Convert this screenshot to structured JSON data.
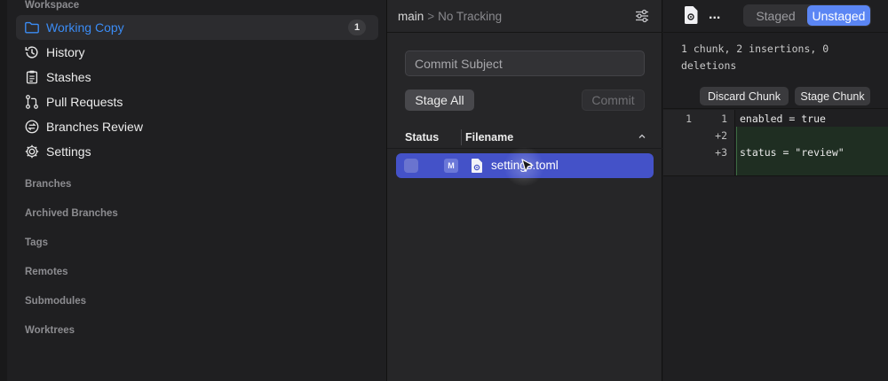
{
  "sidebar": {
    "workspace_header": "Workspace",
    "items": [
      {
        "label": "Working Copy",
        "icon": "folder-icon",
        "badge": "1",
        "active": true
      },
      {
        "label": "History",
        "icon": "history-clock-icon"
      },
      {
        "label": "Stashes",
        "icon": "clipboard-icon"
      },
      {
        "label": "Pull Requests",
        "icon": "pull-request-icon"
      },
      {
        "label": "Branches Review",
        "icon": "branches-review-icon"
      },
      {
        "label": "Settings",
        "icon": "gear-icon"
      }
    ],
    "sections": [
      "Branches",
      "Archived Branches",
      "Tags",
      "Remotes",
      "Submodules",
      "Worktrees"
    ]
  },
  "middle": {
    "branch": "main",
    "separator": ">",
    "tracking": "No Tracking",
    "commit_placeholder": "Commit Subject",
    "stage_all_label": "Stage All",
    "commit_label": "Commit",
    "table": {
      "col_status": "Status",
      "col_filename": "Filename",
      "rows": [
        {
          "status_badge": "M",
          "filename": "settings.toml",
          "selected": true
        }
      ]
    }
  },
  "right": {
    "more_label": "...",
    "tabs": [
      {
        "label": "Staged",
        "active": false
      },
      {
        "label": "Unstaged",
        "active": true
      }
    ],
    "stats": "1 chunk, 2 insertions, 0 deletions",
    "discard_chunk_label": "Discard Chunk",
    "stage_chunk_label": "Stage Chunk",
    "diff_lines": [
      {
        "old": "1",
        "new": "1",
        "code": "enabled = true",
        "type": "context"
      },
      {
        "old": "",
        "new": "+2",
        "code": "",
        "type": "added"
      },
      {
        "old": "",
        "new": "+3",
        "code": "status = \"review\"",
        "type": "added"
      }
    ]
  },
  "colors": {
    "accent": "#3b8cf5",
    "selection": "#4452c8",
    "segment_active": "#5b86f4",
    "added_line": "#1f2e22"
  }
}
